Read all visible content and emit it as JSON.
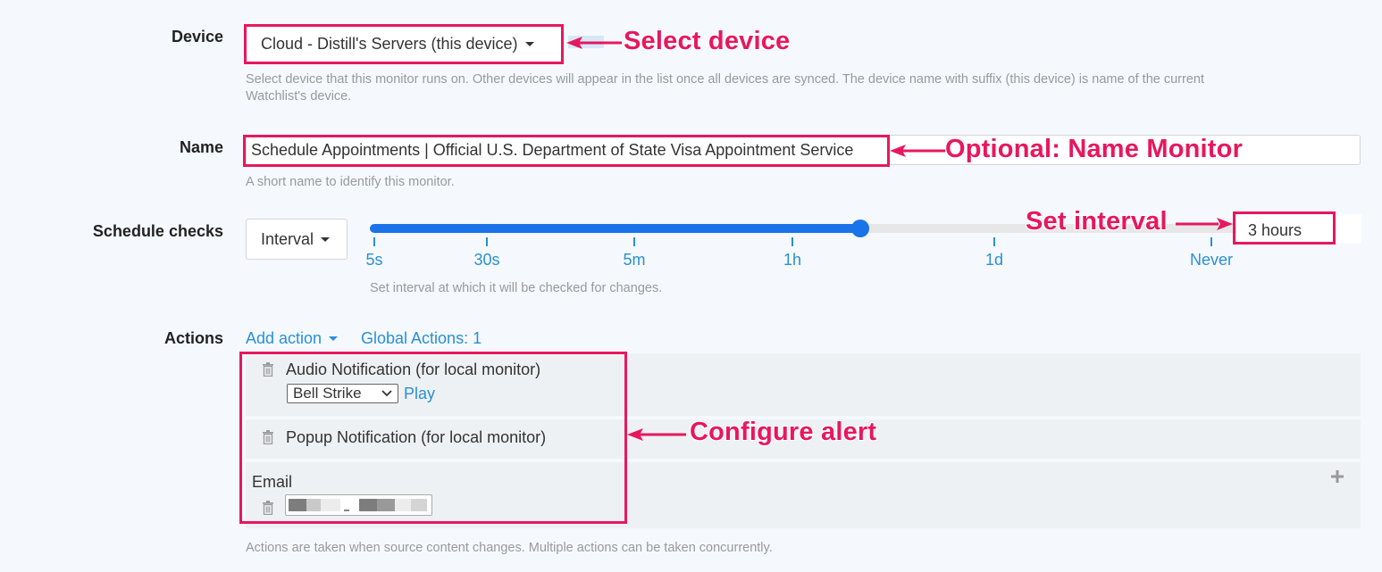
{
  "device": {
    "label": "Device",
    "selected": "Cloud - Distill's Servers (this device)",
    "help_line1": "Select device that this monitor runs on. Other devices will appear in the list once all devices are synced. The device name with suffix (this device) is name of the current",
    "help_line2": "Watchlist's device."
  },
  "name": {
    "label": "Name",
    "value": "Schedule Appointments | Official U.S. Department of State Visa Appointment Service",
    "help": "A short name to identify this monitor."
  },
  "schedule": {
    "label": "Schedule checks",
    "mode": "Interval",
    "slider_fraction": 0.575,
    "ticks": [
      "5s",
      "30s",
      "5m",
      "1h",
      "1d",
      "Never"
    ],
    "value": "3 hours",
    "help": "Set interval at which it will be checked for changes."
  },
  "actions": {
    "label": "Actions",
    "add_action": "Add action",
    "global_actions": "Global Actions: 1",
    "audio": "Audio Notification (for local monitor)",
    "sound_selected": "Bell Strike",
    "play": "Play",
    "popup": "Popup Notification (for local monitor)",
    "email": "Email",
    "help": "Actions are taken when source content changes. Multiple actions can be taken concurrently."
  },
  "annotations": {
    "select_device": "Select device",
    "name_monitor": "Optional: Name Monitor",
    "set_interval": "Set interval",
    "configure_alert": "Configure alert"
  },
  "colors": {
    "accent": "#2a8fd6",
    "annotation": "#e8175d",
    "slider_fill": "#1a73e8"
  }
}
